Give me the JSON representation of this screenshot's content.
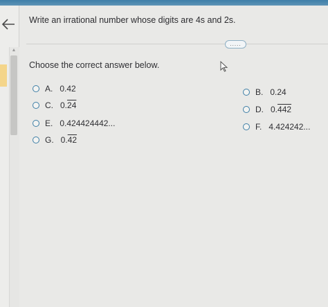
{
  "question": {
    "text": "Write an irrational number whose digits are 4s and 2s."
  },
  "more_button": {
    "label": "....."
  },
  "instruction": "Choose the correct answer below.",
  "options": [
    {
      "letter": "A.",
      "value": "0.42"
    },
    {
      "letter": "B.",
      "value": "0.24"
    },
    {
      "letter": "C.",
      "prefix": "0.",
      "repeating": "24"
    },
    {
      "letter": "D.",
      "prefix": "0.",
      "repeating": "442"
    },
    {
      "letter": "E.",
      "value": "0.424424442..."
    },
    {
      "letter": "F.",
      "value": "4.424242..."
    },
    {
      "letter": "G.",
      "prefix": "0.",
      "repeating": "42"
    }
  ],
  "colors": {
    "accent": "#3d7ea6",
    "topbar": "#4a86ad"
  },
  "icons": {
    "back": "back-arrow-icon",
    "cursor": "mouse-pointer-icon"
  }
}
